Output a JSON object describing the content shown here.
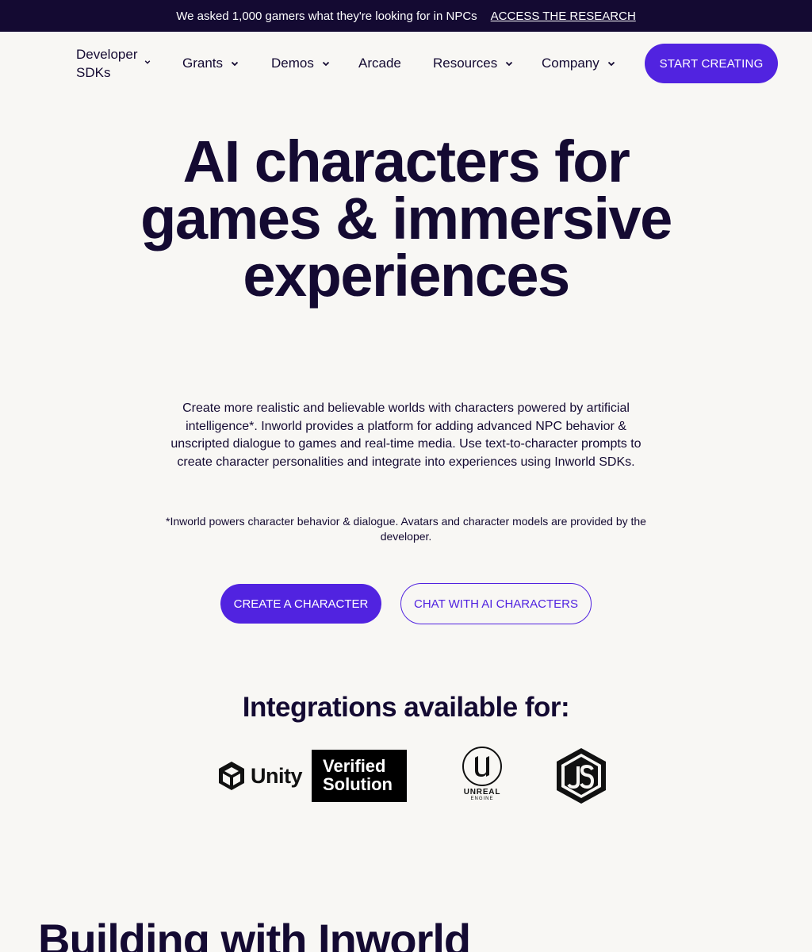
{
  "banner": {
    "text": "We asked 1,000 gamers what they're looking for in NPCs",
    "link": "ACCESS THE RESEARCH"
  },
  "nav": {
    "developer_sdks": "Developer SDKs",
    "grants": "Grants",
    "demos": "Demos",
    "arcade": "Arcade",
    "resources": "Resources",
    "company": "Company",
    "start_creating": "START CREATING"
  },
  "hero": {
    "title": "AI characters for games & immersive experiences",
    "subtitle": "Create more realistic and believable worlds with characters powered by artificial intelligence*. Inworld provides a platform for adding advanced NPC behavior & unscripted dialogue to games and real-time media. Use text-to-character prompts to create character personalities and integrate into experiences using Inworld SDKs.",
    "note": "*Inworld powers character behavior & dialogue. Avatars and character models are provided by the developer.",
    "cta_primary": "CREATE A CHARACTER",
    "cta_secondary": "CHAT WITH AI CHARACTERS"
  },
  "integrations": {
    "title": "Integrations available for:",
    "logos": [
      {
        "name": "unity-logo",
        "text": "Unity"
      },
      {
        "name": "verified-solution-logo",
        "line1": "Verified",
        "line2": "Solution"
      },
      {
        "name": "unreal-engine-logo",
        "line1": "UNREAL",
        "line2": "ENGINE"
      },
      {
        "name": "nodejs-logo",
        "icon": "nodejs-hexagon-icon"
      }
    ]
  },
  "section": {
    "title": "Building with Inworld"
  },
  "colors": {
    "dark": "#140a32",
    "accent": "#5123e0",
    "background": "#f8f7f4"
  }
}
